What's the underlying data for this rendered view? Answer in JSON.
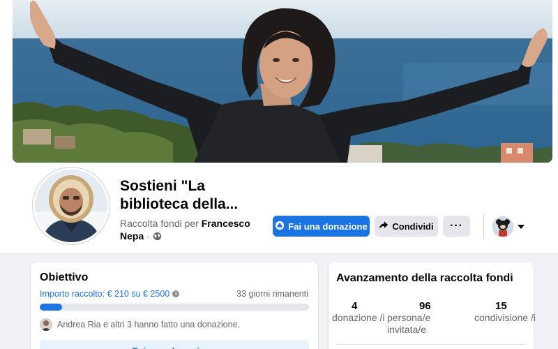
{
  "fundraiser": {
    "title": "Sostieni \"La biblioteca della...",
    "subtitle_prefix": "Raccolta fondi per",
    "organizer": "Francesco Nepa",
    "subtitle_suffix": "·"
  },
  "actions": {
    "donate_label": "Fai una donazione",
    "share_label": "Condividi",
    "more_label": "···"
  },
  "goal": {
    "heading": "Obiettivo",
    "raised_text": "Importo raccolto: € 210 su € 2500",
    "days_left": "33 giorni rimanenti",
    "raised": 210,
    "target": 2500,
    "donors_text": "Andrea Ria e altri 3 hanno fatto una donazione.",
    "cta_label": "Fai una donazione"
  },
  "progress": {
    "heading": "Avanzamento della raccolta fondi",
    "stats": [
      {
        "value": "4",
        "label": "donazione /i"
      },
      {
        "value": "96",
        "label": "persona/e invitata/e"
      },
      {
        "value": "15",
        "label": "condivisione /i"
      }
    ]
  },
  "colors": {
    "accent": "#1b74e4",
    "page_bg": "#f0f2f5"
  }
}
